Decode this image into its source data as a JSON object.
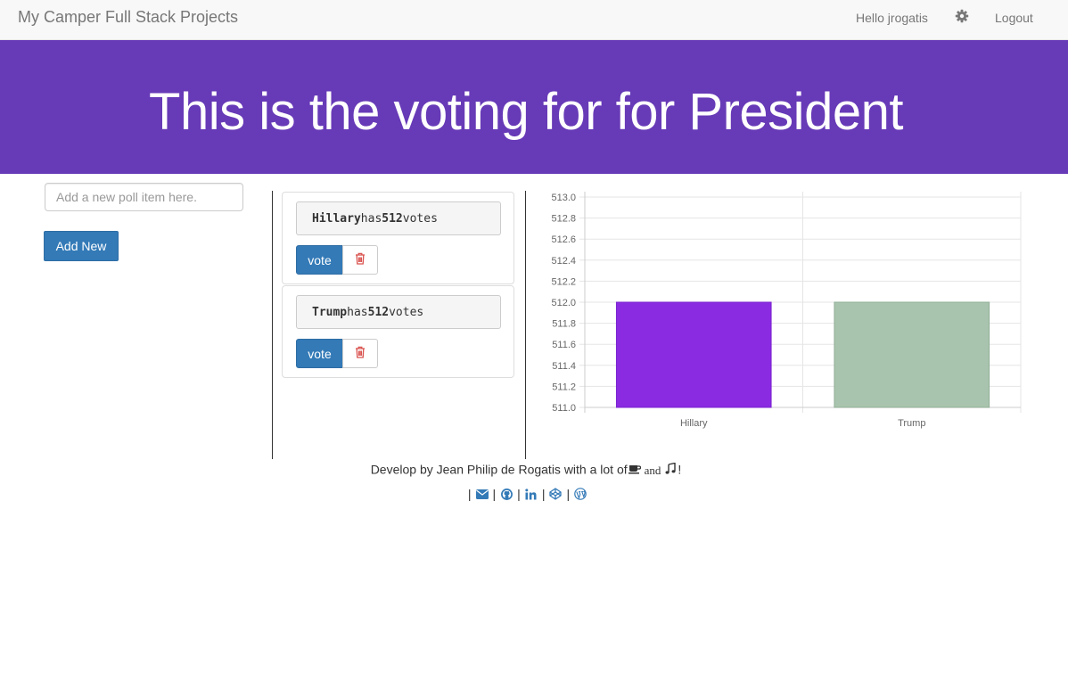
{
  "navbar": {
    "brand": "My Camper Full Stack Projects",
    "greeting": "Hello jrogatis",
    "settings_icon": "gear-icon",
    "logout": "Logout"
  },
  "banner": {
    "title": "This is the voting for for President"
  },
  "form": {
    "placeholder": "Add a new poll item here.",
    "add_label": "Add New"
  },
  "polls": [
    {
      "name": "Hillary",
      "has": "has",
      "votes": "512",
      "votes_word": "votes",
      "vote_label": "vote",
      "delete_icon": "trash-icon"
    },
    {
      "name": "Trump",
      "has": "has",
      "votes": "512",
      "votes_word": "votes",
      "vote_label": "vote",
      "delete_icon": "trash-icon"
    }
  ],
  "chart_data": {
    "type": "bar",
    "categories": [
      "Hillary",
      "Trump"
    ],
    "values": [
      512,
      512
    ],
    "ylim": [
      511,
      513
    ],
    "yticks": [
      "511.0",
      "511.2",
      "511.4",
      "511.6",
      "511.8",
      "512.0",
      "512.2",
      "512.4",
      "512.6",
      "512.8",
      "513.0"
    ],
    "colors": [
      "#8a2be2",
      "#a9c4ae"
    ],
    "grid": true
  },
  "footer": {
    "credit": "Develop by Jean Philip de Rogatis with a lot of",
    "and": "and",
    "end": "!",
    "separator": "|",
    "icons": [
      "coffee-icon",
      "music-icon",
      "envelope-icon",
      "github-icon",
      "linkedin-icon",
      "codepen-icon",
      "wordpress-icon"
    ],
    "link_color": "#337ab7"
  },
  "colors": {
    "banner": "#673ab7",
    "primary": "#337ab7",
    "danger": "#d9534f"
  }
}
